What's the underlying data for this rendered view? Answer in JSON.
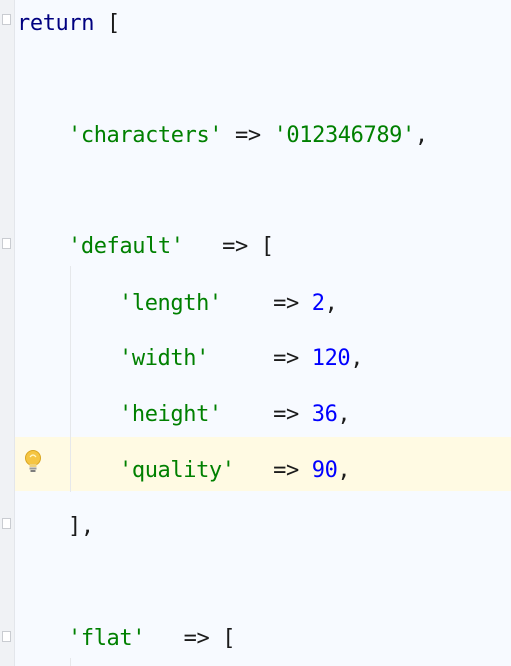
{
  "code": {
    "return_keyword": "return",
    "open_bracket": "[",
    "characters_key": "'characters'",
    "characters_arrow": "=>",
    "characters_value": "'012346789'",
    "characters_comma": ",",
    "default_key": "'default'",
    "default_arrow": "=>",
    "default_open": "[",
    "length_key": "'length'",
    "length_arrow": "=>",
    "length_value": "2",
    "length_comma": ",",
    "width_key": "'width'",
    "width_arrow": "=>",
    "width_value": "120",
    "width_comma": ",",
    "height_key": "'height'",
    "height_arrow": "=>",
    "height_value": "36",
    "height_comma": ",",
    "quality_key": "'quality'",
    "quality_arrow": "=>",
    "quality_value": "90",
    "quality_comma": ",",
    "default_close": "],",
    "flat_key": "'flat'",
    "flat_arrow": "=>",
    "flat_open": "["
  },
  "icons": {
    "intention": "lightbulb-icon",
    "fold": "fold-marker-icon"
  },
  "colors": {
    "background": "#f7faff",
    "keyword": "#000080",
    "string": "#008000",
    "number": "#0000ff",
    "highlight": "#fffae3"
  }
}
